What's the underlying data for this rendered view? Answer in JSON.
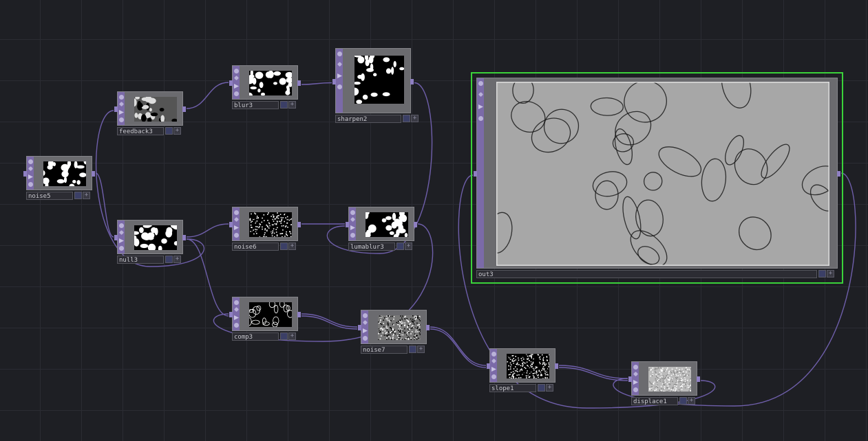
{
  "nodes": [
    {
      "id": "noise5",
      "label": "noise5",
      "thumb": "blobs"
    },
    {
      "id": "feedback3",
      "label": "feedback3",
      "thumb": "dark-blobs"
    },
    {
      "id": "blur3",
      "label": "blur3",
      "thumb": "blobs"
    },
    {
      "id": "sharpen2",
      "label": "sharpen2",
      "thumb": "blobs"
    },
    {
      "id": "null3",
      "label": "null3",
      "thumb": "blobs"
    },
    {
      "id": "noise6",
      "label": "noise6",
      "thumb": "grain"
    },
    {
      "id": "lumablur3",
      "label": "lumablur3",
      "thumb": "blobs"
    },
    {
      "id": "comp3",
      "label": "comp3",
      "thumb": "outline"
    },
    {
      "id": "noise7",
      "label": "noise7",
      "thumb": "gray-noise"
    },
    {
      "id": "slope1",
      "label": "slope1",
      "thumb": "static"
    },
    {
      "id": "displace1",
      "label": "displace1",
      "thumb": "light-grain"
    },
    {
      "id": "out3",
      "label": "out3",
      "thumb": "viewer"
    }
  ],
  "colors": {
    "background": "#1e1f24",
    "wire": "#6f5fab",
    "selection": "#3ad23a",
    "node_strip": "#7b6aa8"
  },
  "icons": [
    "viewer-flag-icon",
    "bypass-flag-icon",
    "display-flag-icon",
    "lock-flag-icon",
    "view-toggle-icon",
    "plus-icon"
  ],
  "buttons": {
    "plus": "+"
  }
}
